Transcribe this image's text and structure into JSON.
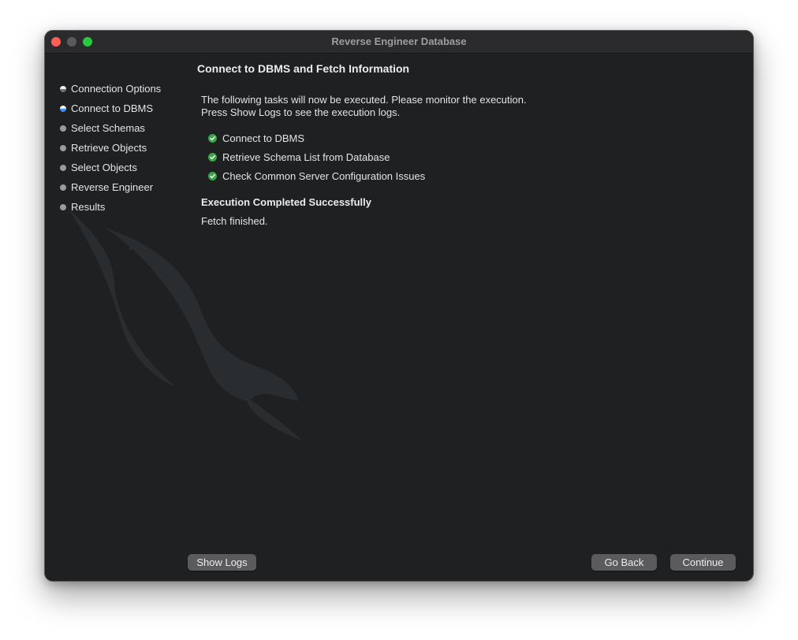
{
  "window": {
    "title": "Reverse Engineer Database"
  },
  "sidebar": {
    "steps": [
      {
        "label": "Connection Options",
        "state": "done"
      },
      {
        "label": "Connect to DBMS",
        "state": "active"
      },
      {
        "label": "Select Schemas",
        "state": "pending"
      },
      {
        "label": "Retrieve Objects",
        "state": "pending"
      },
      {
        "label": "Select Objects",
        "state": "pending"
      },
      {
        "label": "Reverse Engineer",
        "state": "pending"
      },
      {
        "label": "Results",
        "state": "pending"
      }
    ]
  },
  "main": {
    "title": "Connect to DBMS and Fetch Information",
    "intro_line1": "The following tasks will now be executed. Please monitor the execution.",
    "intro_line2": "Press Show Logs to see the execution logs.",
    "tasks": [
      {
        "label": "Connect to DBMS",
        "status": "success"
      },
      {
        "label": "Retrieve Schema List from Database",
        "status": "success"
      },
      {
        "label": "Check Common Server Configuration Issues",
        "status": "success"
      }
    ],
    "status_title": "Execution Completed Successfully",
    "status_text": "Fetch finished."
  },
  "footer": {
    "show_logs_label": "Show Logs",
    "go_back_label": "Go Back",
    "continue_label": "Continue"
  },
  "colors": {
    "window_bg": "#1f2021",
    "titlebar_bg": "#2b2b2d",
    "success_check": "#3aa449",
    "active_step": "#3d8ef3",
    "button_bg": "#5b5b5d"
  }
}
